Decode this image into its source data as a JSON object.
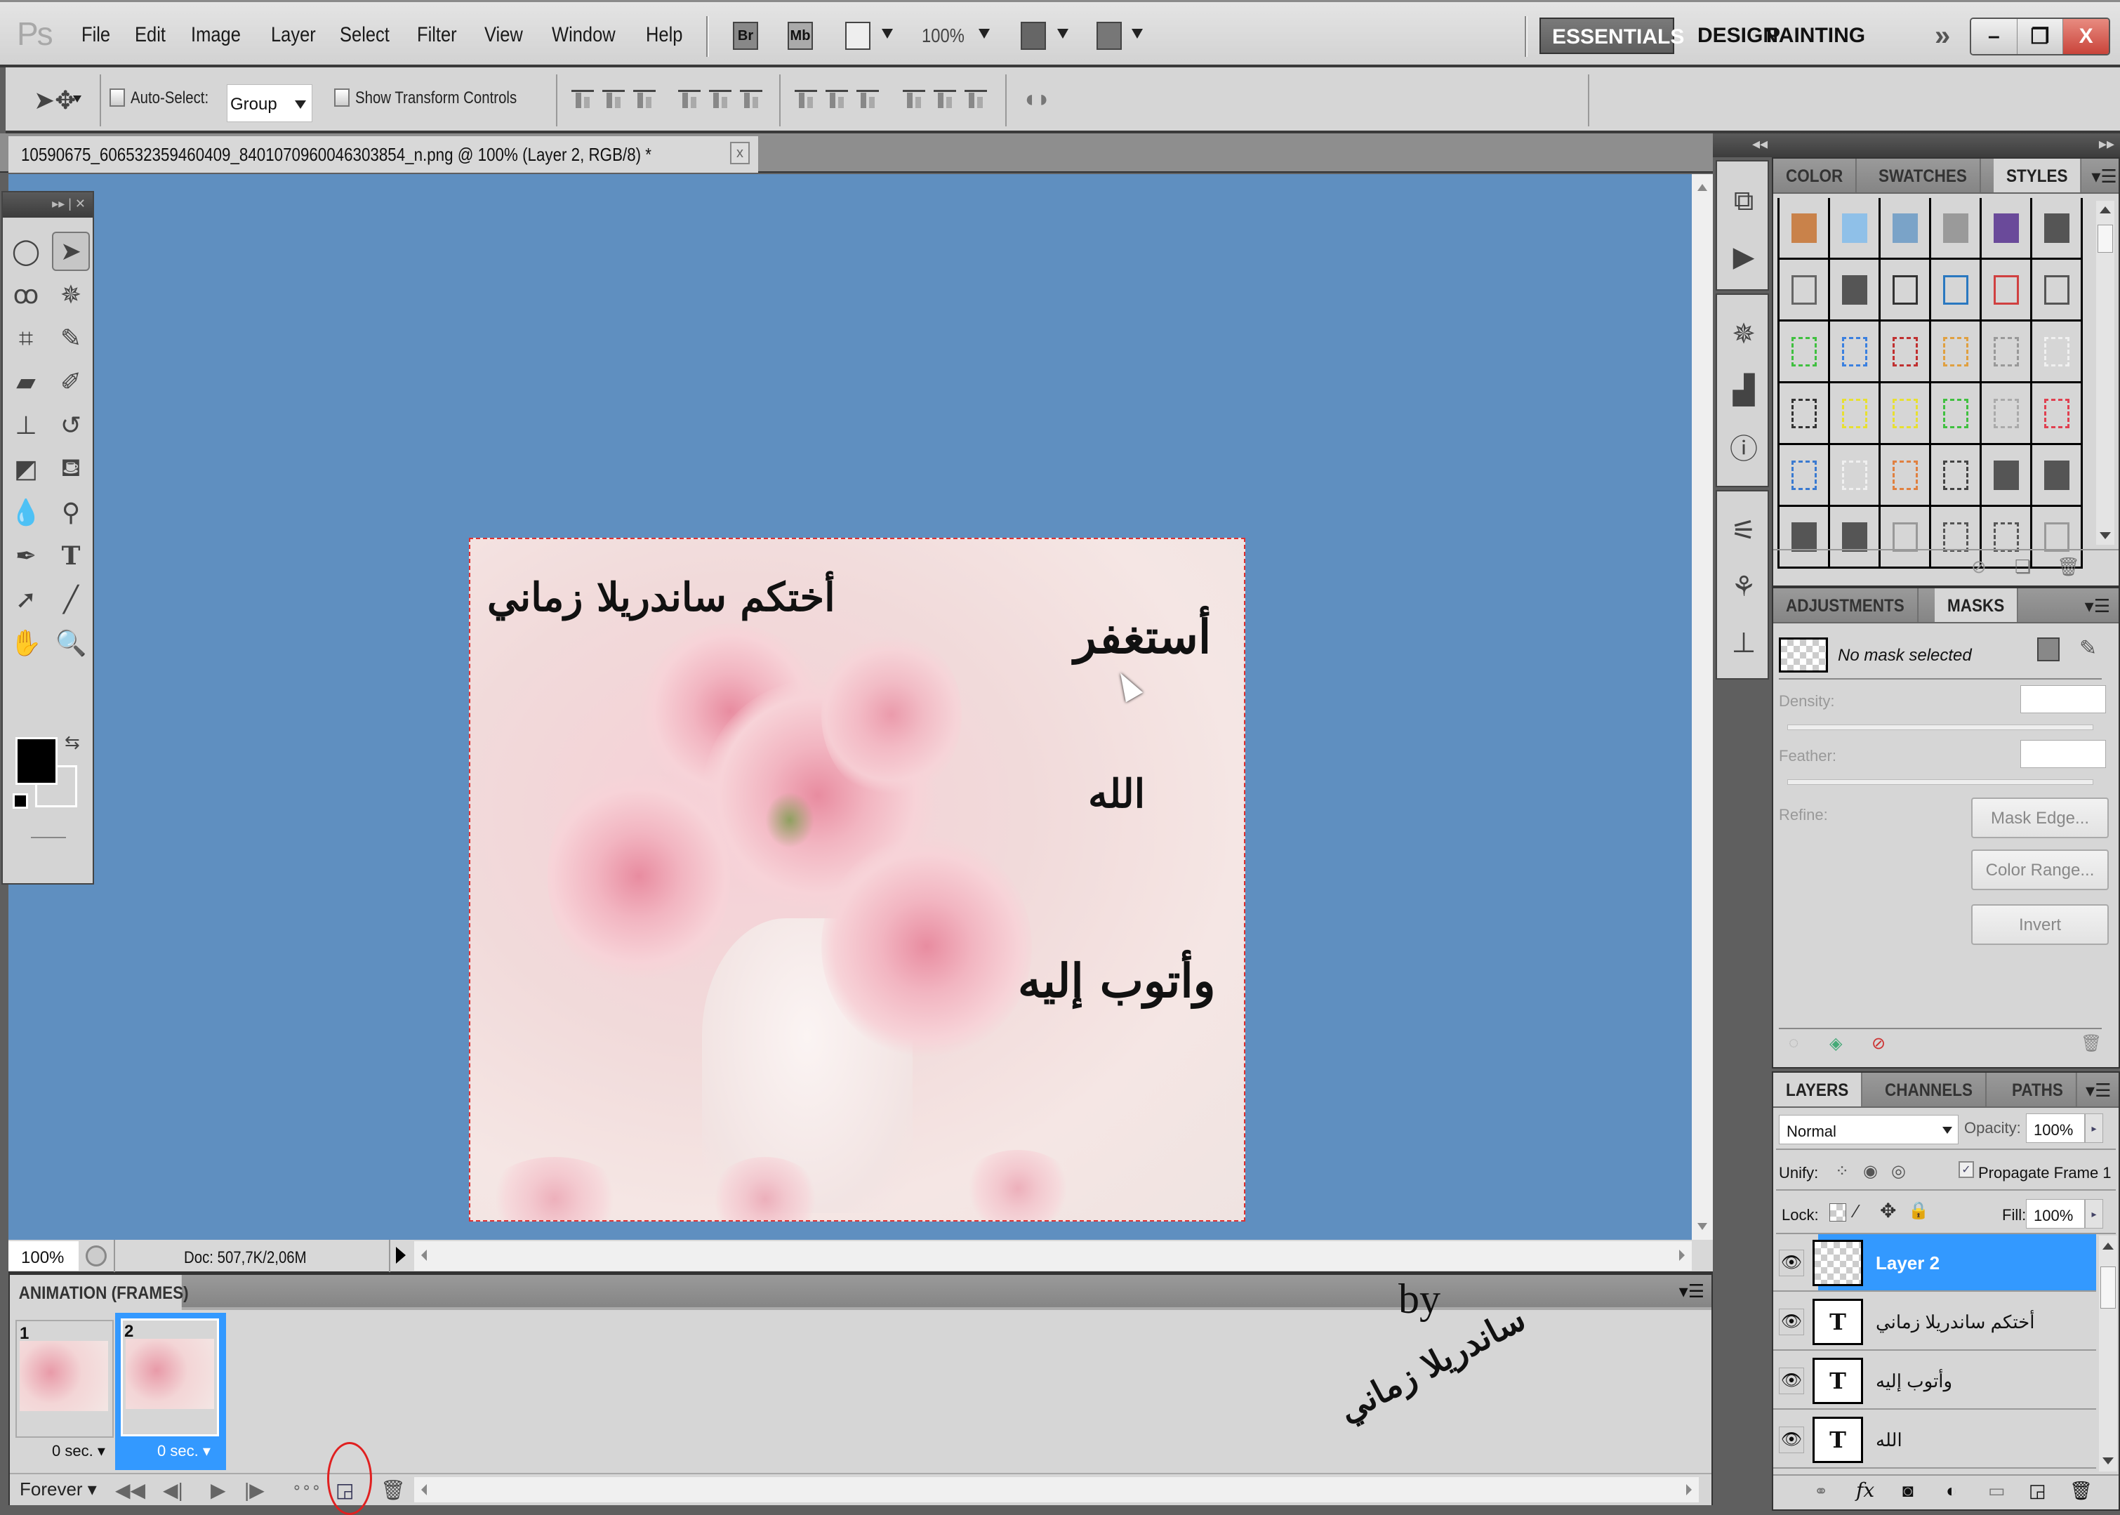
{
  "app": {
    "logo": "Ps"
  },
  "menu": [
    "File",
    "Edit",
    "Image",
    "Layer",
    "Select",
    "Filter",
    "View",
    "Window",
    "Help"
  ],
  "appbar": {
    "bridge": "Br",
    "minibridge": "Mb",
    "zoom": "100%"
  },
  "workspaces": {
    "active": "ESSENTIALS",
    "items": [
      "DESIGN",
      "PAINTING"
    ],
    "more": "»"
  },
  "window_controls": {
    "minimize": "–",
    "restore": "❐",
    "close": "X"
  },
  "options_bar": {
    "auto_select_label": "Auto-Select:",
    "auto_select_checked": false,
    "auto_select_value": "Group",
    "show_transform_label": "Show Transform Controls",
    "show_transform_checked": false
  },
  "document": {
    "tab_title": "10590675_606532359460409_8401070960046303854_n.png @ 100% (Layer 2, RGB/8) *",
    "close": "x",
    "zoom": "100%",
    "doc_info": "Doc: 507,7K/2,06M",
    "artwork": {
      "line_top_left": "أختكم ساندريلا زماني",
      "line_1": "أستغفر",
      "line_2": "الله",
      "line_3": "وأتوب إليه"
    }
  },
  "toolbox": {
    "header": "▸▸ | ✕"
  },
  "styles_panel": {
    "tabs": [
      "COLOR",
      "SWATCHES",
      "STYLES"
    ],
    "active_tab": "STYLES",
    "swatches": [
      {
        "type": "fill",
        "color": "#c9824a"
      },
      {
        "type": "fill",
        "color": "#8fc0e8"
      },
      {
        "type": "fill",
        "color": "#7aa3c8"
      },
      {
        "type": "fill",
        "color": "#9a9a9a"
      },
      {
        "type": "fill",
        "color": "#6a4a9a"
      },
      {
        "type": "fill",
        "color": "#555555"
      },
      {
        "type": "outline",
        "color": "#666666"
      },
      {
        "type": "fill",
        "color": "#555555"
      },
      {
        "type": "outline",
        "color": "#333333"
      },
      {
        "type": "outline",
        "color": "#2a78c0"
      },
      {
        "type": "outline",
        "color": "#d04040"
      },
      {
        "type": "outline",
        "color": "#555555"
      },
      {
        "type": "dashed",
        "color": "#40c040"
      },
      {
        "type": "dashed",
        "color": "#3a80e0"
      },
      {
        "type": "dashed",
        "color": "#c03030"
      },
      {
        "type": "dashed",
        "color": "#e0a040"
      },
      {
        "type": "dashed",
        "color": "#999999"
      },
      {
        "type": "dashed",
        "color": "#f0f0f0"
      },
      {
        "type": "dashed",
        "color": "#333333"
      },
      {
        "type": "dashed",
        "color": "#e8e030"
      },
      {
        "type": "dashed",
        "color": "#e8e030"
      },
      {
        "type": "dashed",
        "color": "#40c040"
      },
      {
        "type": "dashed",
        "color": "#aaaaaa"
      },
      {
        "type": "dashed",
        "color": "#e04050"
      },
      {
        "type": "dashed",
        "color": "#3a7ad0"
      },
      {
        "type": "dashed",
        "color": "#f0f0f0"
      },
      {
        "type": "dashed",
        "color": "#e08040"
      },
      {
        "type": "dashed",
        "color": "#444444"
      },
      {
        "type": "fill",
        "color": "#555555"
      },
      {
        "type": "fill",
        "color": "#555555"
      },
      {
        "type": "fill",
        "color": "#555555"
      },
      {
        "type": "fill",
        "color": "#555555"
      },
      {
        "type": "outline",
        "color": "#999999"
      },
      {
        "type": "dashed",
        "color": "#555555"
      },
      {
        "type": "dashed",
        "color": "#555555"
      },
      {
        "type": "outline",
        "color": "#999999"
      }
    ]
  },
  "masks_panel": {
    "tabs": [
      "ADJUSTMENTS",
      "MASKS"
    ],
    "active_tab": "MASKS",
    "status": "No mask selected",
    "density_label": "Density:",
    "feather_label": "Feather:",
    "refine_label": "Refine:",
    "buttons": [
      "Mask Edge...",
      "Color Range...",
      "Invert"
    ]
  },
  "layers_panel": {
    "tabs": [
      "LAYERS",
      "CHANNELS",
      "PATHS"
    ],
    "active_tab": "LAYERS",
    "blend_mode": "Normal",
    "opacity_label": "Opacity:",
    "opacity": "100%",
    "unify_label": "Unify:",
    "propagate_label": "Propagate Frame 1",
    "propagate_checked": true,
    "lock_label": "Lock:",
    "fill_label": "Fill:",
    "fill": "100%",
    "layers": [
      {
        "name": "Layer 2",
        "type": "raster",
        "selected": true,
        "visible": true
      },
      {
        "name": "أختكم ساندريلا زماني",
        "type": "text",
        "selected": false,
        "visible": true
      },
      {
        "name": "وأتوب إليه",
        "type": "text",
        "selected": false,
        "visible": true
      },
      {
        "name": "الله",
        "type": "text",
        "selected": false,
        "visible": true
      }
    ]
  },
  "animation_panel": {
    "title": "ANIMATION (FRAMES)",
    "frames": [
      {
        "number": "1",
        "delay": "0 sec.",
        "selected": false
      },
      {
        "number": "2",
        "delay": "0 sec.",
        "selected": true
      }
    ],
    "loop": "Forever",
    "watermark_by": "by",
    "watermark_name": "ساندريلا زماني"
  },
  "colors": {
    "canvas_bg": "#5f8fc0",
    "selection": "#3399ff",
    "highlight_circle": "#e02020"
  }
}
